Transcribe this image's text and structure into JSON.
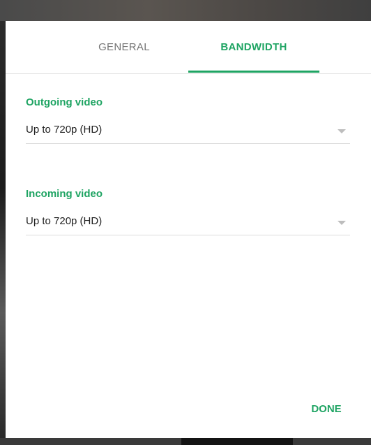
{
  "tabs": [
    {
      "label": "GENERAL",
      "selected": false
    },
    {
      "label": "BANDWIDTH",
      "selected": true
    }
  ],
  "outgoing": {
    "label": "Outgoing video",
    "value": "Up to 720p (HD)"
  },
  "incoming": {
    "label": "Incoming video",
    "value": "Up to 720p (HD)"
  },
  "actions": {
    "done_label": "DONE"
  },
  "colors": {
    "accent": "#1fa463",
    "inactive_tab": "#757575",
    "divider": "#e3e3e3",
    "text": "#212121"
  }
}
